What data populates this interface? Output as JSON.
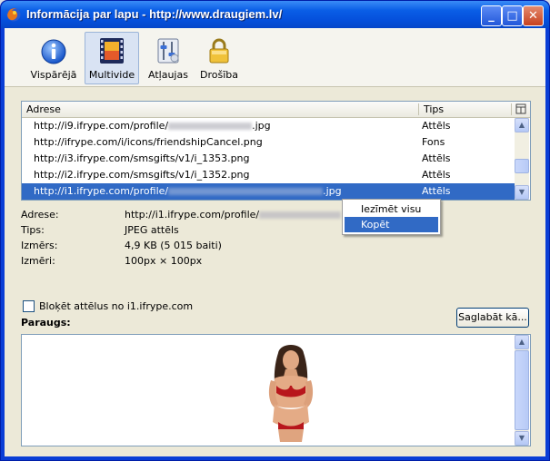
{
  "window": {
    "title": "Informācija par lapu - http://www.draugiem.lv/",
    "minimize": "_",
    "maximize": "□",
    "close": "✕",
    "title_icon": "firefox-icon"
  },
  "toolbar": {
    "tabs": [
      {
        "label": "Vispārējā",
        "icon": "info-icon",
        "active": false
      },
      {
        "label": "Multivide",
        "icon": "film-strip-icon",
        "active": true
      },
      {
        "label": "Atļaujas",
        "icon": "permissions-sliders-icon",
        "active": false
      },
      {
        "label": "Drošība",
        "icon": "padlock-icon",
        "active": false
      }
    ]
  },
  "media_list": {
    "columns": {
      "address": "Adrese",
      "type": "Tips"
    },
    "rows": [
      {
        "addr_prefix": "http://i9.ifrype.com/profile/",
        "addr_suffix": ".jpg",
        "type": "Attēls",
        "redacted": true
      },
      {
        "addr_prefix": "http://ifrype.com/i/icons/friendshipCancel.png",
        "addr_suffix": "",
        "type": "Fons",
        "redacted": false
      },
      {
        "addr_prefix": "http://i3.ifrype.com/smsgifts/v1/i_1353.png",
        "addr_suffix": "",
        "type": "Attēls",
        "redacted": false
      },
      {
        "addr_prefix": "http://i2.ifrype.com/smsgifts/v1/i_1352.png",
        "addr_suffix": "",
        "type": "Attēls",
        "redacted": false
      },
      {
        "addr_prefix": "http://i1.ifrype.com/profile/",
        "addr_suffix": ".jpg",
        "type": "Attēls",
        "redacted": true,
        "selected": true
      }
    ]
  },
  "details": {
    "address_label": "Adrese:",
    "address_value": "http://i1.ifrype.com/profile/",
    "type_label": "Tips:",
    "type_value": "JPEG attēls",
    "size_label": "Izmērs:",
    "size_value": "4,9 KB (5 015 baiti)",
    "dims_label": "Izmēri:",
    "dims_value": "100px × 100px"
  },
  "context_menu": {
    "items": [
      {
        "label": "Iezīmēt visu",
        "highlighted": false
      },
      {
        "label": "Kopēt",
        "highlighted": true
      }
    ]
  },
  "block_images": {
    "label": "Bloķēt attēlus no i1.ifrype.com",
    "checked": false
  },
  "save_button": "Saglabāt kā...",
  "preview_label": "Paraugs:"
}
